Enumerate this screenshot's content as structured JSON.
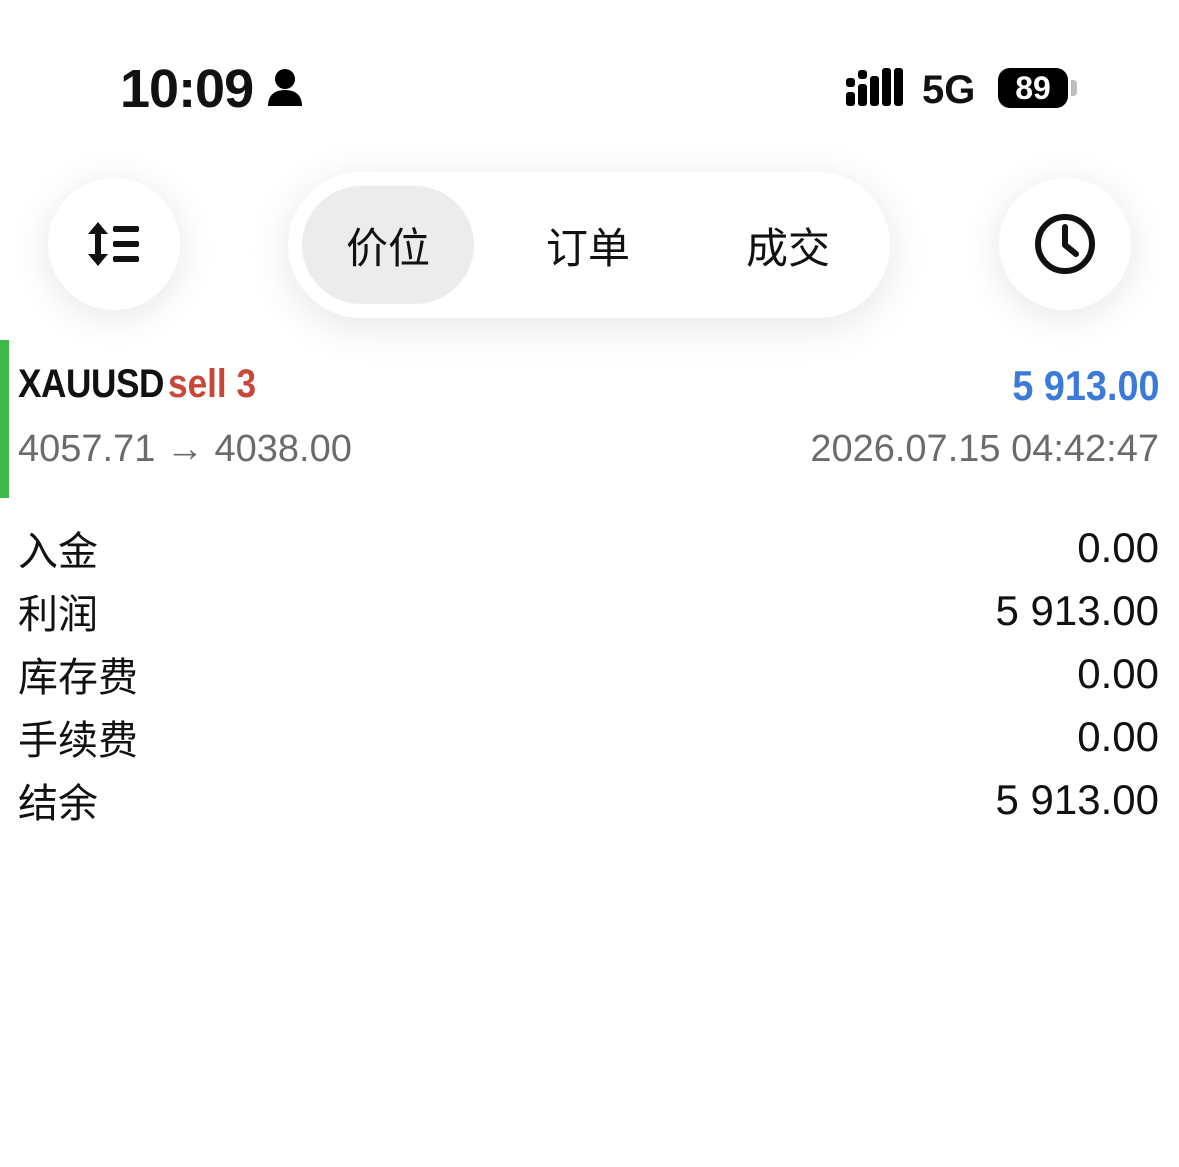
{
  "status_bar": {
    "time": "10:09",
    "network": "5G",
    "battery": "89"
  },
  "toolbar": {
    "tabs": [
      {
        "label": "价位",
        "active": true
      },
      {
        "label": "订单",
        "active": false
      },
      {
        "label": "成交",
        "active": false
      }
    ],
    "icons": {
      "left": "sort-list-icon",
      "right": "clock-icon"
    }
  },
  "trade": {
    "symbol": "XAUUSD",
    "side": "sell 3",
    "profit": "5 913.00",
    "price_route": "4057.71 → 4038.00",
    "datetime": "2026.07.15 04:42:47",
    "colors": {
      "marker": "#3fb74a",
      "side": "#c9473a",
      "profit": "#3b7ad8"
    }
  },
  "summary": [
    {
      "label": "入金",
      "value": "0.00"
    },
    {
      "label": "利润",
      "value": "5 913.00"
    },
    {
      "label": "库存费",
      "value": "0.00"
    },
    {
      "label": "手续费",
      "value": "0.00"
    },
    {
      "label": "结余",
      "value": "5 913.00"
    }
  ]
}
